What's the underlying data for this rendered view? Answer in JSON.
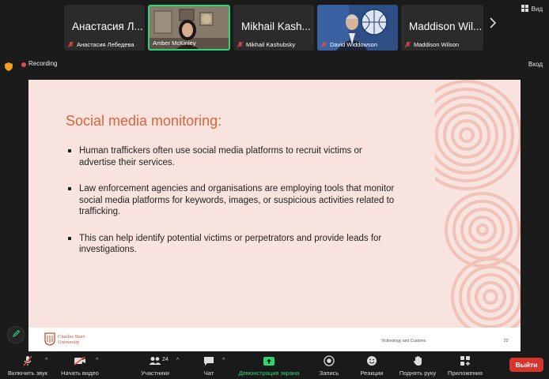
{
  "gallery": {
    "view_label": "Вид",
    "participants": [
      {
        "big_name": "Анастасия Л...",
        "name": "Анастасия Лебедева",
        "muted": true
      },
      {
        "big_name": "",
        "name": "Amber McKinley",
        "muted": false,
        "active": true
      },
      {
        "big_name": "Mikhail Kash...",
        "name": "Mikhail Kashubsky",
        "muted": true
      },
      {
        "big_name": "",
        "name": "David Widdowson",
        "muted": true
      },
      {
        "big_name": "Maddison Wil...",
        "name": "Maddison Wilson",
        "muted": true
      }
    ]
  },
  "status": {
    "recording_label": "Recording",
    "exit_label": "Вход"
  },
  "slide": {
    "title": "Social media monitoring:",
    "bullets": [
      "Human traffickers often use social media platforms to recruit victims or advertise their services.",
      "Law enforcement agencies and organisations are employing tools that monitor social media platforms for keywords, images, or suspicious activities related to trafficking.",
      "This can help identify potential victims or perpetrators and provide leads for investigations."
    ],
    "logo_line1": "Charles Sturt",
    "logo_line2": "University",
    "course": "Victimology and Customs",
    "page": "22"
  },
  "toolbar": {
    "mute_label": "Включить звук",
    "video_label": "Начать видео",
    "participants_label": "Участники",
    "participants_count": "24",
    "chat_label": "Чат",
    "share_label": "Демонстрация экрана",
    "record_label": "Запись",
    "reactions_label": "Реакции",
    "raise_hand_label": "Поднять руку",
    "apps_label": "Приложения",
    "leave_label": "Выйти"
  },
  "colors": {
    "accent_green": "#2ed573",
    "slide_bg": "#f9e3df",
    "slide_title": "#d9643c",
    "leave_red": "#d9342b"
  }
}
